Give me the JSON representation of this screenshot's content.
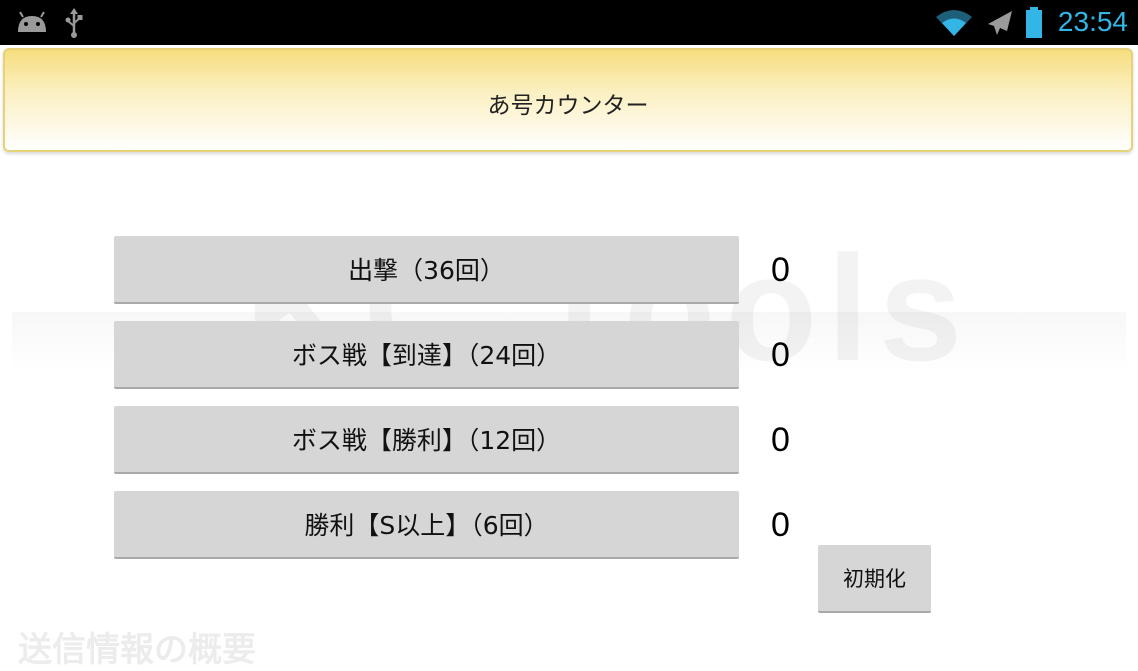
{
  "status_bar": {
    "time": "23:54",
    "left_icons": [
      "android-icon",
      "usb-icon"
    ],
    "right_icons": [
      "wifi-icon",
      "airplane-icon",
      "battery-icon"
    ],
    "accent_color": "#33b5e5"
  },
  "header": {
    "title": "あ号カウンター"
  },
  "watermark": {
    "text": "KC Tools"
  },
  "counters": [
    {
      "label": "出撃（36回）",
      "count": "0"
    },
    {
      "label": "ボス戦【到達】（24回）",
      "count": "0"
    },
    {
      "label": "ボス戦【勝利】（12回）",
      "count": "0"
    },
    {
      "label": "勝利【S以上】（6回）",
      "count": "0"
    }
  ],
  "reset_label": "初期化",
  "bottom_peek_text": "送信情報の概要"
}
